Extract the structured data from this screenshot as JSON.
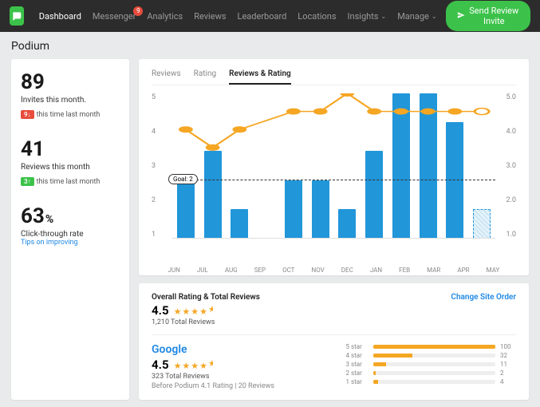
{
  "nav": {
    "items": [
      "Dashboard",
      "Messenger",
      "Analytics",
      "Reviews",
      "Leaderboard",
      "Locations",
      "Insights",
      "Manage"
    ],
    "active": 0,
    "badge_index": 1,
    "badge_value": "9"
  },
  "cta_label": "Send Review Invite",
  "page_title": "Podium",
  "stats": {
    "invites": {
      "value": "89",
      "label": "Invites this month.",
      "trend_dir": "down",
      "trend_value": "9↓",
      "trend_text": "this time last month"
    },
    "reviews": {
      "value": "41",
      "label": "Reviews this month",
      "trend_dir": "up",
      "trend_value": "3↑",
      "trend_text": "this time last month"
    },
    "ctr": {
      "value": "63",
      "suffix": "%",
      "label": "Click-through rate",
      "link": "Tips on improving"
    }
  },
  "tabs": [
    "Reviews",
    "Rating",
    "Reviews & Rating"
  ],
  "active_tab": 2,
  "goal_label": "Goal: 2",
  "chart_data": {
    "type": "bar+line",
    "categories": [
      "JUN",
      "JUL",
      "AUG",
      "SEP",
      "OCT",
      "NOV",
      "DEC",
      "JAN",
      "FEB",
      "MAR",
      "APR",
      "MAY"
    ],
    "series": [
      {
        "name": "Reviews",
        "values": [
          2,
          3,
          1,
          0,
          2,
          2,
          1,
          3,
          5,
          5,
          4,
          1
        ],
        "axis": "left"
      },
      {
        "name": "Rating",
        "values": [
          4.0,
          3.5,
          4.0,
          null,
          4.5,
          4.5,
          5.0,
          4.5,
          4.5,
          4.5,
          4.5,
          4.5
        ],
        "axis": "right"
      }
    ],
    "ylim_left": [
      0,
      5
    ],
    "ylim_right": [
      1.0,
      5.0
    ],
    "ylabel_left": "",
    "ylabel_right": "",
    "goal": 2,
    "hatched_index": 11
  },
  "y_left": [
    "5",
    "4",
    "3",
    "2",
    "1"
  ],
  "y_right": [
    "5.0",
    "4.0",
    "3.0",
    "2.0",
    "1.0"
  ],
  "overall": {
    "title": "Overall Rating & Total Reviews",
    "rating": "4.5",
    "total": "1,210 Total Reviews",
    "change": "Change Site Order"
  },
  "provider": {
    "name": "Google",
    "rating": "4.5",
    "total": "323 Total Reviews",
    "before": "Before Podium  4.1 Rating | 20 Reviews",
    "dist": [
      {
        "label": "5 star",
        "value": 100,
        "pct": 100
      },
      {
        "label": "4 star",
        "value": 32,
        "pct": 32
      },
      {
        "label": "3 star",
        "value": 11,
        "pct": 11
      },
      {
        "label": "2 star",
        "value": 2,
        "pct": 2
      },
      {
        "label": "1 star",
        "value": 4,
        "pct": 4
      }
    ]
  },
  "stars_display": "★★★★½"
}
